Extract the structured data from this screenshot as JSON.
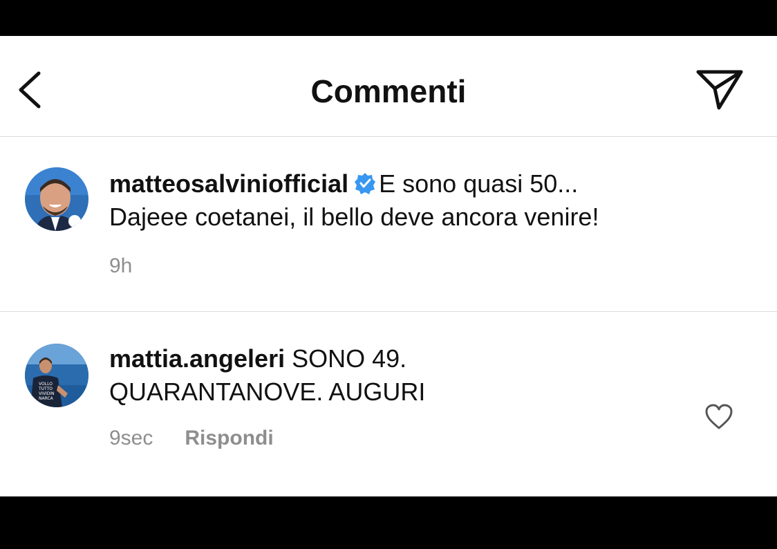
{
  "header": {
    "title": "Commenti",
    "back_icon": "chevron-left-icon",
    "share_icon": "paper-plane-icon"
  },
  "caption": {
    "username": "matteosalviniofficial",
    "verified": true,
    "text_line1": "E sono quasi 50...",
    "text_line2": "Dajeee coetanei, il bello deve ancora venire!",
    "time": "9h"
  },
  "comment": {
    "username": "mattia.angeleri",
    "text_line1": "SONO 49.",
    "text_line2": "QUARANTANOVE. AUGURI",
    "time": "9sec",
    "reply_label": "Rispondi",
    "like_icon": "heart-outline-icon"
  },
  "colors": {
    "verified_blue": "#3897f0",
    "meta_gray": "#8e8e8e",
    "divider": "#dcdcdc"
  }
}
